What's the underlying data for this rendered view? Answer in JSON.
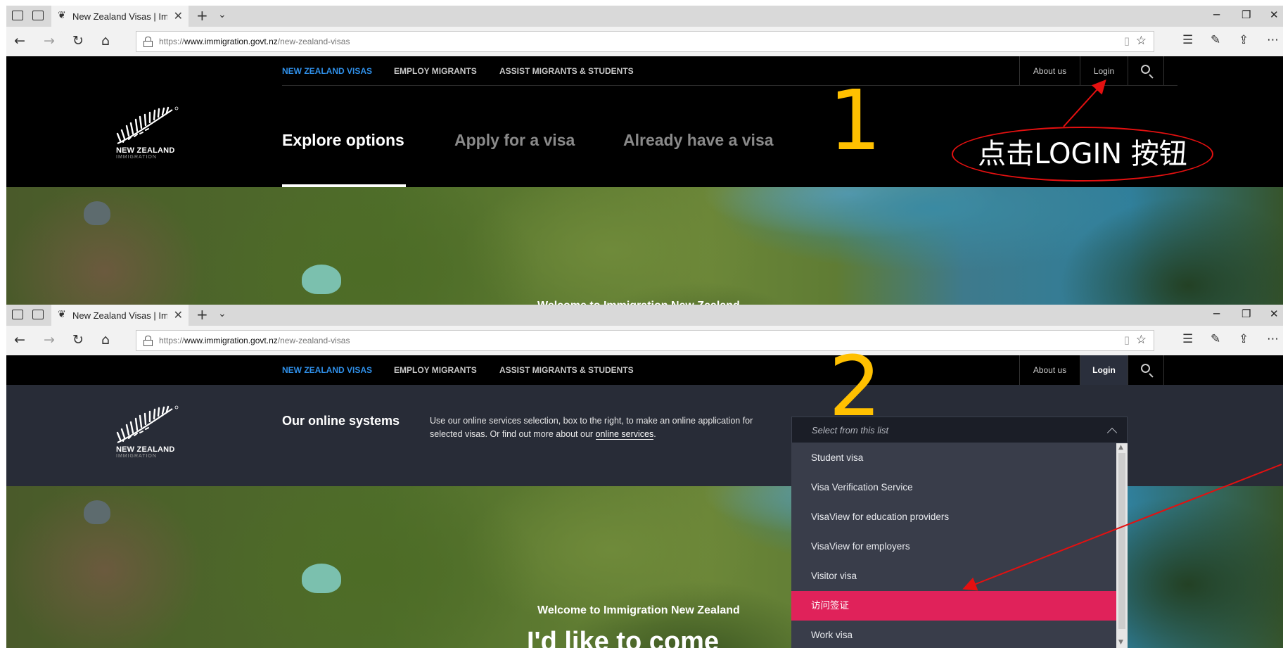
{
  "browser": {
    "tab_title": "New Zealand Visas | Immigration New Zealand",
    "url_prefix": "https://",
    "url_domain": "www.immigration.govt.nz",
    "url_path": "/new-zealand-visas"
  },
  "topnav": {
    "new_zealand_visas": "NEW ZEALAND VISAS",
    "employ_migrants": "EMPLOY MIGRANTS",
    "assist_migrants": "ASSIST MIGRANTS & STUDENTS",
    "about_us": "About us",
    "login": "Login"
  },
  "logo": {
    "name": "NEW ZEALAND",
    "sub": "IMMIGRATION"
  },
  "main_tabs": [
    "Explore options",
    "Apply for a visa",
    "Already have a visa"
  ],
  "hero": {
    "welcome": "Welcome to Immigration New Zealand",
    "headline": "I'd like to come"
  },
  "online_systems": {
    "title": "Our online systems",
    "desc_part1": "Use our online services selection, box to the right, to make an online application for selected visas. Or find out more about our ",
    "desc_link": "online services",
    "desc_end": "."
  },
  "select": {
    "placeholder": "Select from this list",
    "options": [
      "Student visa",
      "Visa Verification Service",
      "VisaView for education providers",
      "VisaView for employers",
      "Visitor visa",
      "访问签证",
      "Work visa"
    ],
    "highlighted_index": 5
  },
  "annotations": {
    "step1": "1",
    "step2": "2",
    "step1_label": "点击LOGIN 按钮"
  },
  "colors": {
    "accent_blue": "#2f8fe8",
    "highlight_pink": "#e0225a",
    "annotation_yellow": "#ffc000",
    "annotation_red": "#e41010"
  }
}
